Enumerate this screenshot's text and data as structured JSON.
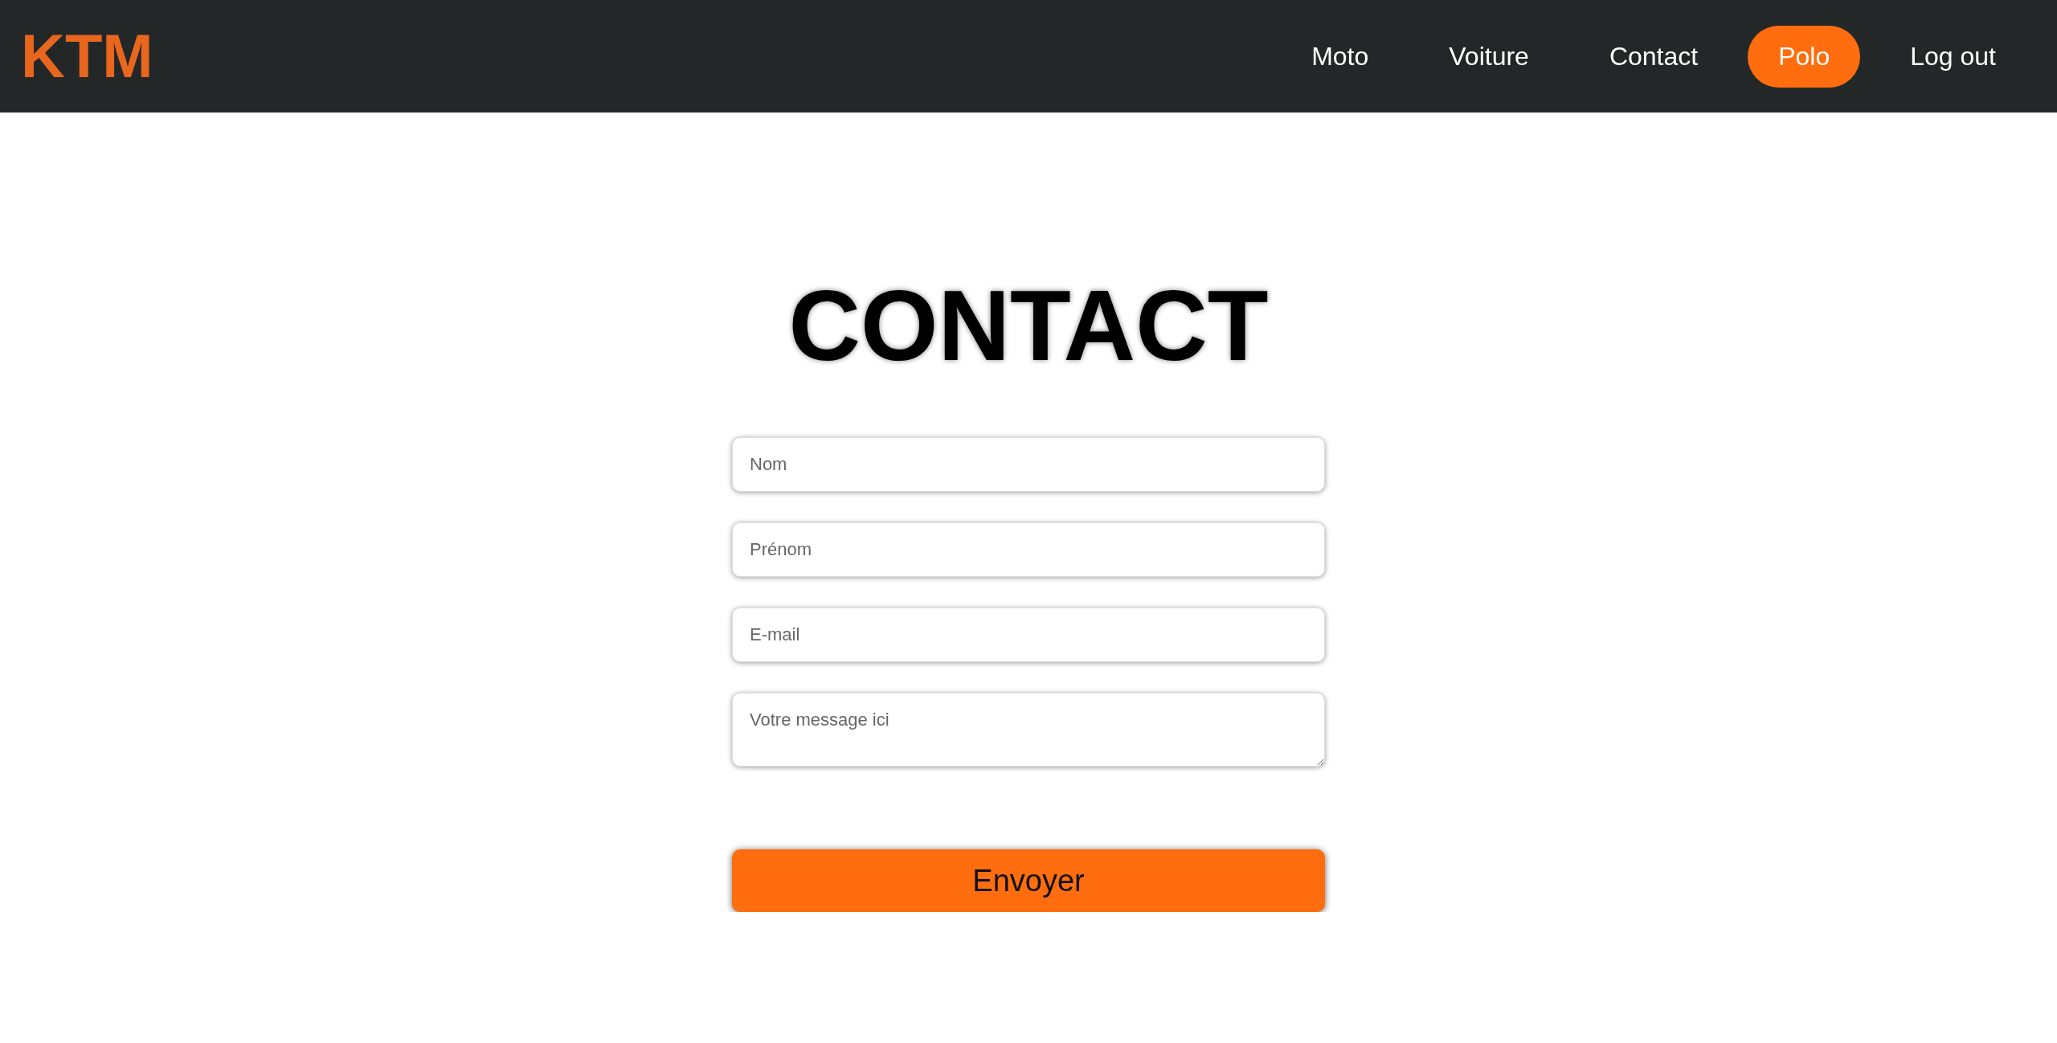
{
  "header": {
    "logo": "KTM",
    "nav": [
      {
        "label": "Moto",
        "selected": false
      },
      {
        "label": "Voiture",
        "selected": false
      },
      {
        "label": "Contact",
        "selected": false
      },
      {
        "label": "Polo",
        "selected": true
      },
      {
        "label": "Log out",
        "selected": false
      }
    ]
  },
  "form": {
    "title": "CONTACT",
    "fields": [
      {
        "kind": "input",
        "placeholder": "Nom"
      },
      {
        "kind": "input",
        "placeholder": "Prénom"
      },
      {
        "kind": "input",
        "placeholder": "E-mail"
      },
      {
        "kind": "textarea",
        "placeholder": "Votre message ici"
      }
    ],
    "submit": "Envoyer"
  }
}
